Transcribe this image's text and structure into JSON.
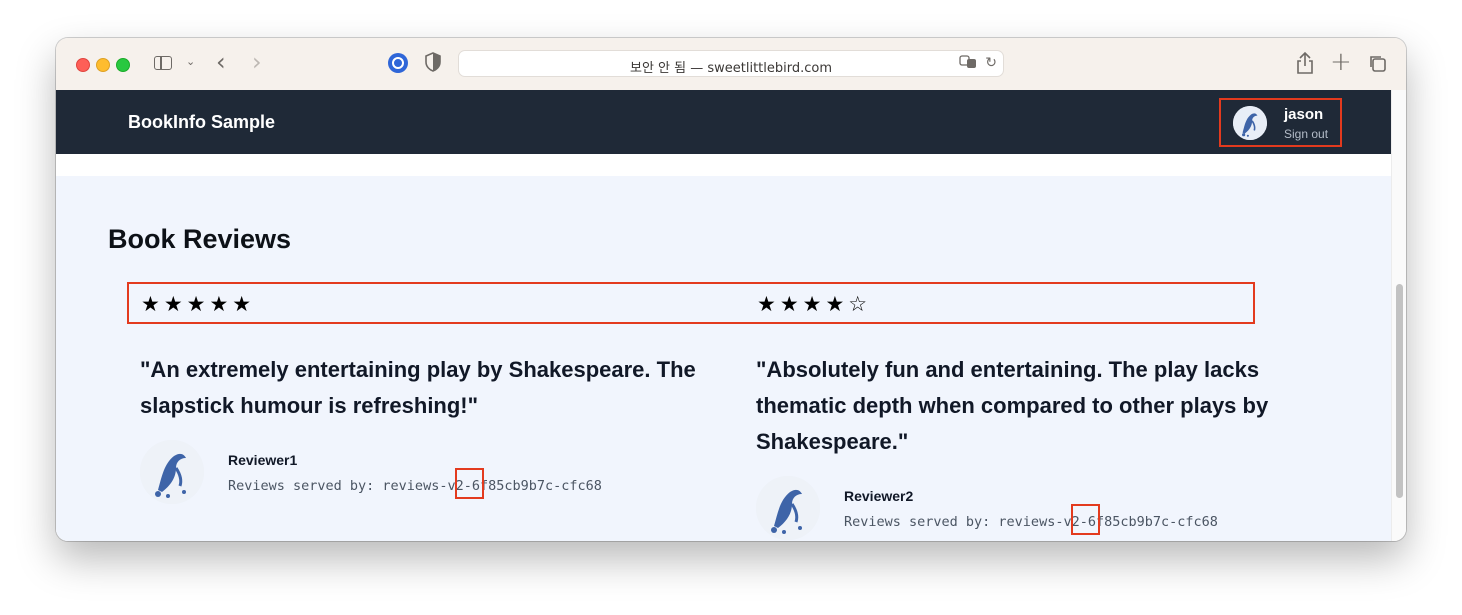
{
  "browser": {
    "address": "보안 안 됨 — sweetlittlebird.com",
    "icons": [
      "sidebar-icon",
      "chevron-down-icon",
      "back-icon",
      "forward-icon",
      "password-manager-icon",
      "shield-icon",
      "translate-icon",
      "reload-icon",
      "share-icon",
      "plus-icon",
      "tabs-icon"
    ]
  },
  "navbar": {
    "brand": "BookInfo Sample",
    "user": {
      "name": "jason",
      "sign_out": "Sign out"
    }
  },
  "reviews": {
    "title": "Book Reviews",
    "items": [
      {
        "stars": "★★★★★",
        "rating": 5,
        "text": "\"An extremely entertaining play by Shakespeare. The slapstick humour is refreshing!\"",
        "reviewer": "Reviewer1",
        "served_by": "Reviews served by: reviews-v2-6f85cb9b7c-cfc68"
      },
      {
        "stars": "★★★★☆",
        "rating": 4,
        "text": "\"Absolutely fun and entertaining. The play lacks thematic depth when compared to other plays by Shakespeare.\"",
        "reviewer": "Reviewer2",
        "served_by": "Reviews served by: reviews-v2-6f85cb9b7c-cfc68"
      }
    ]
  },
  "colors": {
    "navbar_bg": "#1f2937",
    "content_bg": "#f1f5fd",
    "highlight": "#e33a1e"
  }
}
